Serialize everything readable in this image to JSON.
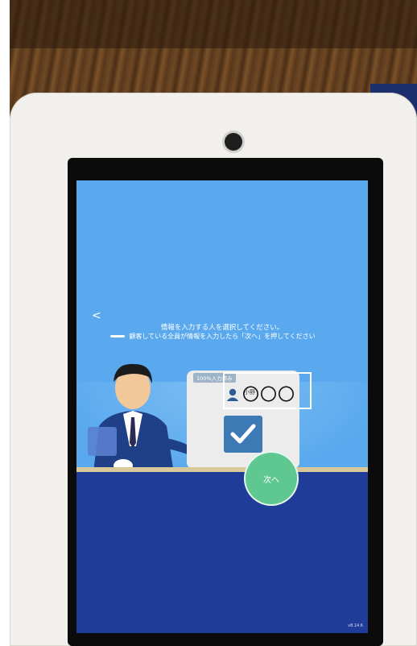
{
  "screen": {
    "back_symbol": "<",
    "instruction_line1": "情報を入力する人を選択してください。",
    "instruction_line2": "顧客している全員が情報を入力したら「次へ」を押してください",
    "card_label": "100%入力済み",
    "user_name_circles": "〇〇〇",
    "user_name_prefix": "小野",
    "next_label": "次へ",
    "version": "v8.14.6"
  },
  "colors": {
    "screen_bg": "#5aa9ee",
    "bottom_bar": "#1f3c99",
    "next_button": "#5ec890",
    "checkbox": "#3d79b4"
  },
  "icons": [
    "camera-icon",
    "back-icon",
    "user-icon",
    "check-icon"
  ]
}
